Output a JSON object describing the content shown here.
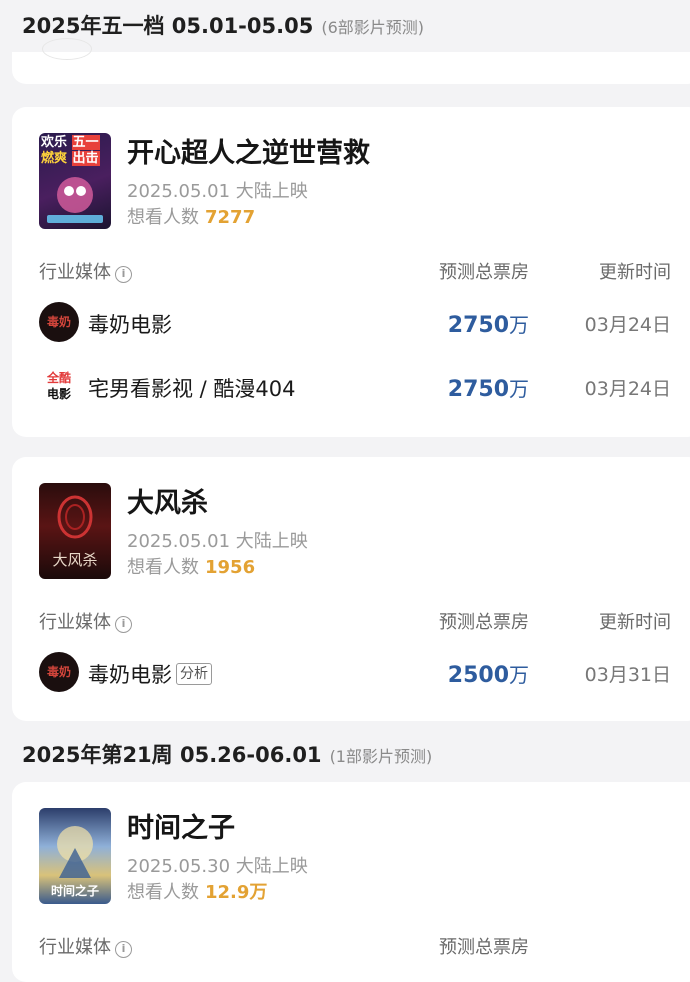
{
  "sections": [
    {
      "title": "2025年五一档 05.01-05.05",
      "count": "(6部影片预测)"
    },
    {
      "title": "2025年第21周 05.26-06.01",
      "count": "(1部影片预测)"
    }
  ],
  "labels": {
    "media_col": "行业媒体",
    "info_icon": "i",
    "box_col": "预测总票房",
    "time_col": "更新时间",
    "want_prefix": "想看人数",
    "unit": "万",
    "analysis_tag": "分析"
  },
  "movies": [
    {
      "title": "开心超人之逆世营救",
      "date": "2025.05.01 大陆上映",
      "want": "7277",
      "poster_text": [
        "欢乐",
        "五一",
        "燃爽",
        "出击"
      ],
      "predictions": [
        {
          "media": "毒奶电影",
          "value": "2750",
          "time": "03月24日"
        },
        {
          "media": "宅男看影视 / 酷漫404",
          "value": "2750",
          "time": "03月24日"
        }
      ]
    },
    {
      "title": "大风杀",
      "date": "2025.05.01 大陆上映",
      "want": "1956",
      "poster_text": [
        "大风杀"
      ],
      "predictions": [
        {
          "media": "毒奶电影",
          "value": "2500",
          "time": "03月31日"
        }
      ]
    },
    {
      "title": "时间之子",
      "date": "2025.05.30 大陆上映",
      "want": "12.9万",
      "poster_text": [
        "时间之子"
      ],
      "predictions": []
    }
  ],
  "media_logos": {
    "dunai_text": "毒奶",
    "quanku_text": [
      "全酷",
      "电影"
    ]
  },
  "colors": {
    "accent_blue": "#2e5c9e",
    "want_orange": "#e3a233",
    "background": "#f3f3f5"
  }
}
